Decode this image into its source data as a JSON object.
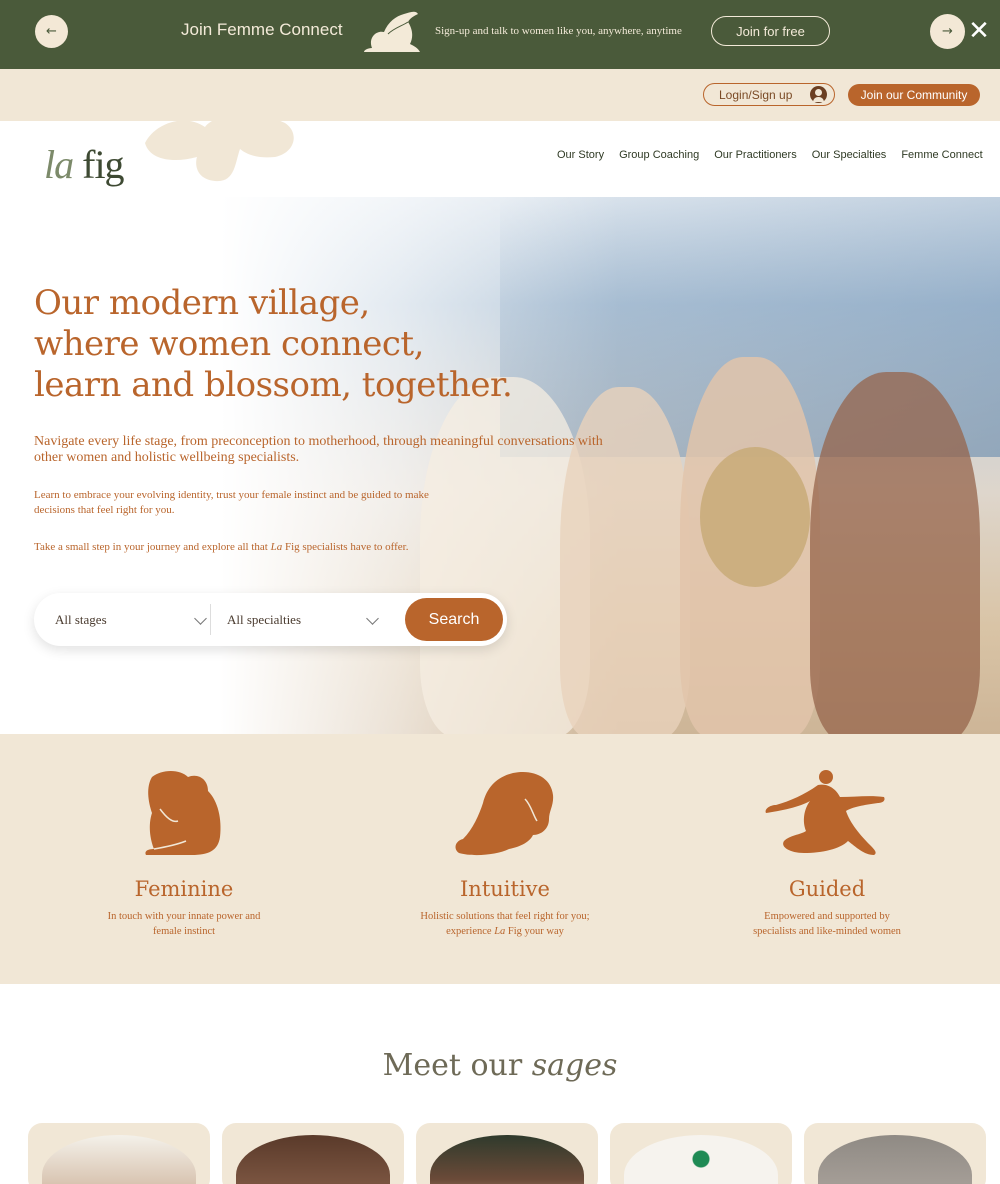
{
  "promo": {
    "title": "Join Femme Connect",
    "text": "Sign-up and talk to women like you, anywhere, anytime",
    "cta": "Join for free",
    "prev_icon": "arrow-left-icon",
    "next_icon": "arrow-right-icon",
    "close_icon": "close-icon",
    "prev_glyph": "←",
    "next_glyph": "→",
    "close_glyph": "✕"
  },
  "utility": {
    "login": "Login/Sign up",
    "community": "Join our Community"
  },
  "nav": {
    "logo_la": "la",
    "logo_fig": "fig",
    "links": [
      "Our Story",
      "Group Coaching",
      "Our Practitioners",
      "Our Specialties",
      "Femme Connect"
    ]
  },
  "hero": {
    "title": "Our modern village,\nwhere women connect,\nlearn and blossom, together.",
    "p1": "Navigate every life stage, from preconception to motherhood, through meaningful conversations with other women and holistic wellbeing specialists.",
    "p2": "Learn to embrace your evolving identity, trust your female instinct and be guided to make decisions that feel right for you.",
    "p3_before": "Take a small step in your journey and explore all that ",
    "p3_brand": "La",
    "p3_after": " Fig specialists have to offer.",
    "stage_select": "All stages",
    "specialty_select": "All specialties",
    "search": "Search"
  },
  "values": [
    {
      "title": "Feminine",
      "desc": "In touch with your innate power and female instinct",
      "icon": "seated-woman-icon"
    },
    {
      "title": "Intuitive",
      "desc_before": "Holistic solutions that feel right for you; experience ",
      "desc_brand": "La",
      "desc_after": " Fig your way",
      "icon": "woman-profile-icon"
    },
    {
      "title": "Guided",
      "desc": "Empowered and supported by specialists and like-minded women",
      "icon": "reclining-woman-icon"
    }
  ],
  "sages": {
    "title_plain": "Meet our ",
    "title_italic": "sages"
  },
  "colors": {
    "accent": "#b9652c",
    "banner": "#4a5a3a",
    "cream": "#f1e7d6"
  }
}
